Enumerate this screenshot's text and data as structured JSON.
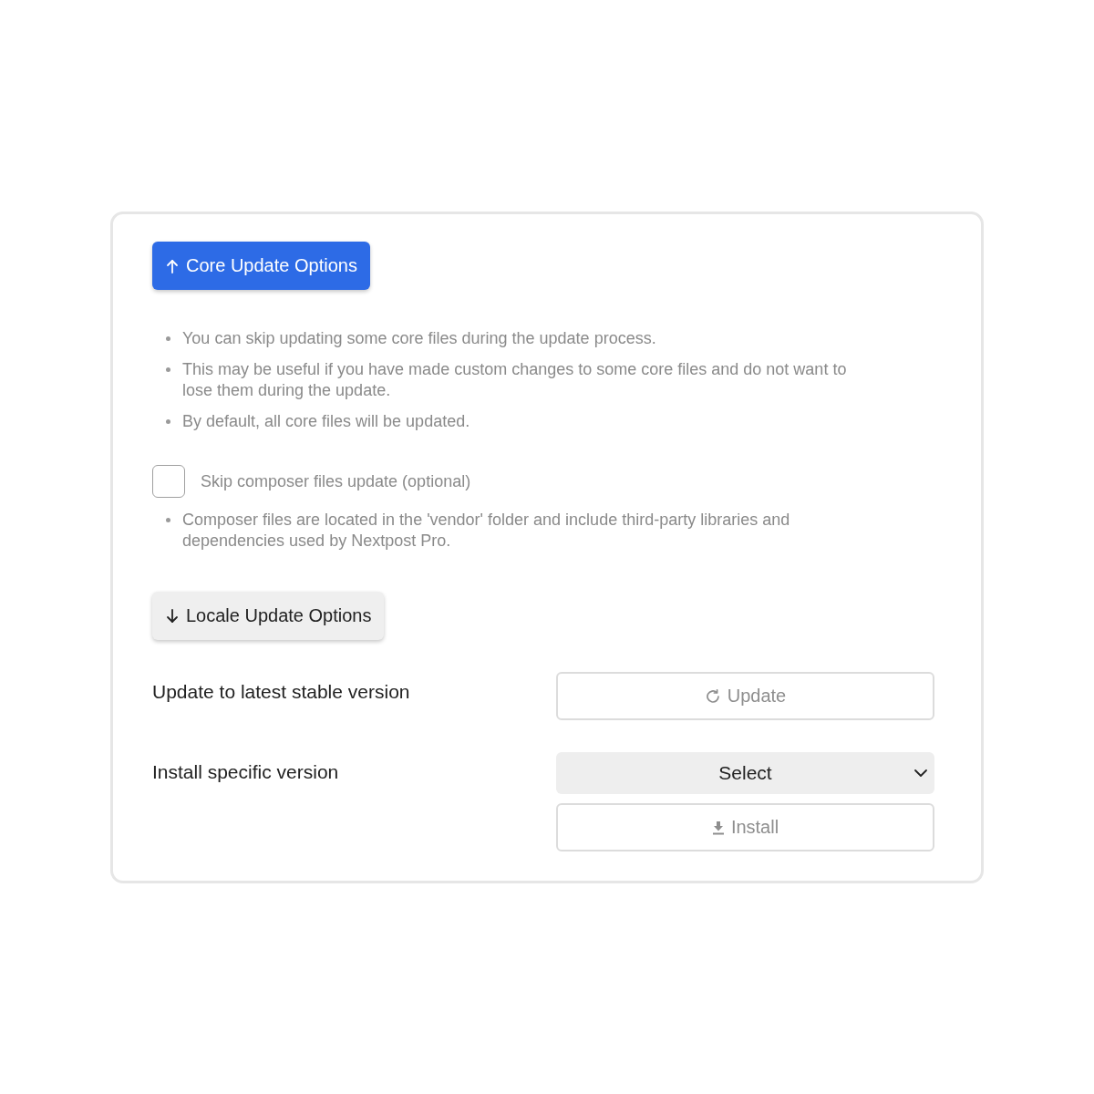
{
  "core_section": {
    "toggle": {
      "label": "Core Update Options",
      "expanded": true
    },
    "notes": [
      "You can skip updating some core files during the update process.",
      "This may be useful if you have made custom changes to some core files and do not want to lose them during the update.",
      "By default, all core files will be updated."
    ],
    "skip_composer": {
      "label": "Skip composer files update (optional)",
      "checked": false
    },
    "composer_notes": [
      "Composer files are located in the 'vendor' folder and include third-party libraries and dependencies used by Nextpost Pro."
    ]
  },
  "locale_section": {
    "toggle": {
      "label": "Locale Update Options",
      "expanded": false
    }
  },
  "update_row": {
    "label": "Update to latest stable version",
    "button": {
      "label": "Update",
      "disabled": true
    }
  },
  "install_row": {
    "label": "Install specific version",
    "select": {
      "value": "Select"
    },
    "button": {
      "label": "Install",
      "disabled": true
    }
  }
}
